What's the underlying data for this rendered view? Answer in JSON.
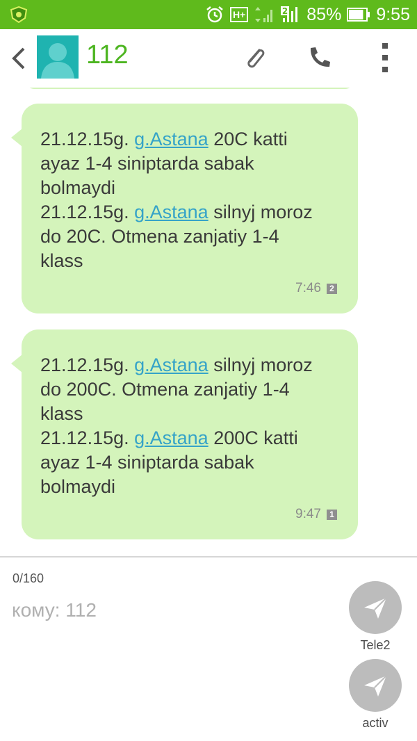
{
  "status_bar": {
    "battery_percent": "85%",
    "time": "9:55",
    "network": "H+",
    "sim_indicator": "2",
    "battery_level": 0.85,
    "icons": [
      "app-shield-icon",
      "alarm-icon",
      "network-h-plus-icon",
      "signal-sim1-icon",
      "signal-sim2-icon",
      "battery-icon"
    ]
  },
  "app_bar": {
    "title": "112",
    "icons": [
      "back-icon",
      "contact-avatar",
      "attach-icon",
      "call-icon",
      "more-vert-icon"
    ]
  },
  "messages": [
    {
      "lines": [
        {
          "before": "21.12.15g. ",
          "link": "g.Astana",
          "after": " 20C katti"
        },
        {
          "text": "ayaz 1-4 siniptarda sabak"
        },
        {
          "text": "bolmaydi"
        },
        {
          "before": "21.12.15g. ",
          "link": "g.Astana",
          "after": " silnyj moroz"
        },
        {
          "text": "do 20C. Otmena zanjatiy 1-4"
        },
        {
          "text": "klass"
        }
      ],
      "time": "7:46",
      "sim": "2"
    },
    {
      "lines": [
        {
          "before": "21.12.15g. ",
          "link": "g.Astana",
          "after": " silnyj moroz"
        },
        {
          "text": "do 200C. Otmena zanjatiy 1-4"
        },
        {
          "text": "klass"
        },
        {
          "before": "21.12.15g. ",
          "link": "g.Astana",
          "after": " 200C katti"
        },
        {
          "text": "ayaz 1-4 siniptarda sabak"
        },
        {
          "text": "bolmaydi"
        }
      ],
      "time": "9:47",
      "sim": "1"
    }
  ],
  "compose": {
    "char_counter": "0/160",
    "recipient_placeholder": "кому: 112",
    "send_buttons": [
      {
        "label": "Tele2"
      },
      {
        "label": "activ"
      }
    ]
  },
  "colors": {
    "status_bar": "#5fba1c",
    "bubble": "#d4f4bb",
    "link": "#35a3c8",
    "title": "#4db521",
    "send_button": "#bcbcbc"
  }
}
